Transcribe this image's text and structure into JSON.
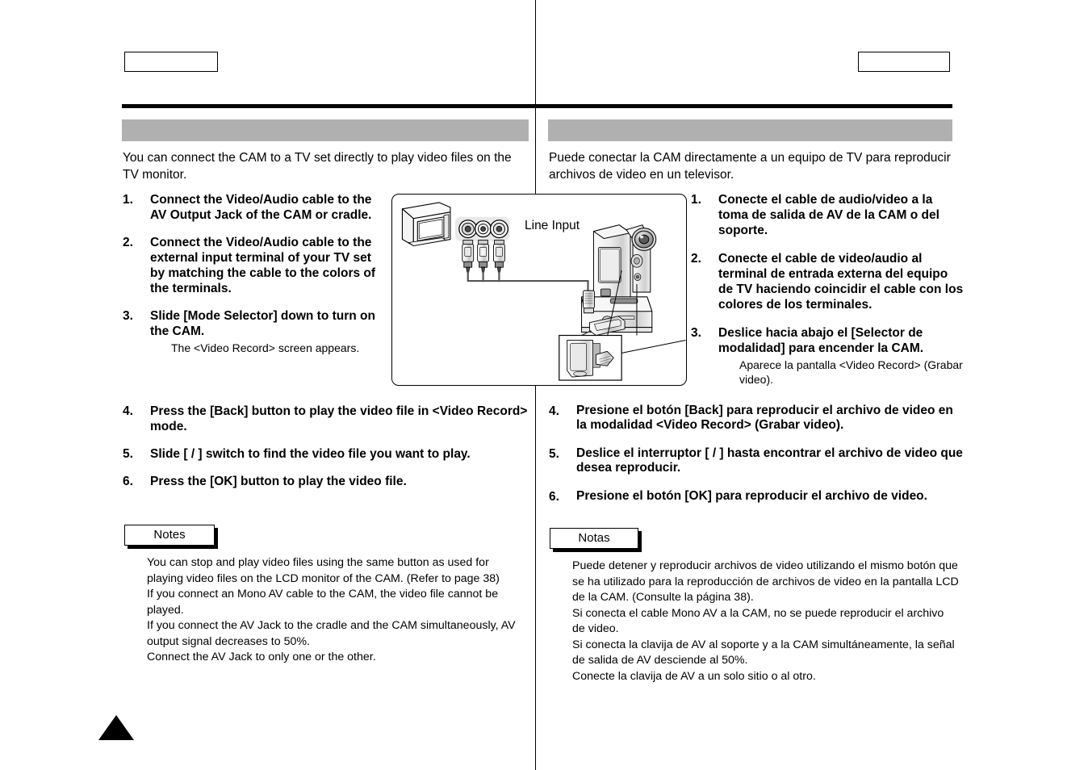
{
  "header": {
    "left_box_label": "",
    "right_box_label": ""
  },
  "section_title": {
    "left": "",
    "right": ""
  },
  "english": {
    "intro": "You can connect the CAM to a TV set directly to play video files on the TV monitor.",
    "steps_top": [
      {
        "num": "1.",
        "text": "Connect the Video/Audio cable to the AV Output Jack of the CAM or cradle.",
        "sub": ""
      },
      {
        "num": "2.",
        "text": "Connect the Video/Audio cable to the external input terminal of your TV set by matching the cable to the colors of the terminals.",
        "sub": ""
      },
      {
        "num": "3.",
        "text": "Slide [Mode Selector] down to turn on the CAM.",
        "sub": "The <Video Record> screen appears."
      }
    ],
    "steps_bottom": [
      {
        "num": "4.",
        "text": "Press the [Back] button to play the video file in <Video Record> mode.",
        "sub": ""
      },
      {
        "num": "5.",
        "text": "Slide [   /   ] switch to find the video file  you want to play.",
        "sub": ""
      },
      {
        "num": "6.",
        "text": "Press the [OK] button to play the video file.",
        "sub": ""
      }
    ],
    "notes_label": "Notes",
    "notes": [
      "You can stop and play video files using the same button as used for playing video files on the LCD monitor of the CAM. (Refer to page 38)",
      "If you connect an Mono AV cable to the CAM, the video file cannot be played.",
      "If you connect the AV Jack to the cradle and the CAM simultaneously, AV output signal decreases to 50%.",
      "Connect the AV Jack to only one or the other."
    ]
  },
  "spanish": {
    "intro": "Puede conectar la CAM directamente a un equipo de TV para reproducir archivos de video en un televisor.",
    "steps_top": [
      {
        "num": "1.",
        "text": "Conecte el cable de audio/video a la toma de salida de AV de la CAM o del soporte.",
        "sub": ""
      },
      {
        "num": "2.",
        "text": "Conecte el cable de video/audio al terminal de entrada externa del equipo de TV haciendo coincidir el cable con los colores de los terminales.",
        "sub": ""
      },
      {
        "num": "3.",
        "text": "Deslice hacia abajo el [Selector de modalidad] para encender la CAM.",
        "sub": "Aparece la pantalla <Video Record> (Grabar video)."
      }
    ],
    "steps_bottom": [
      {
        "num": "4.",
        "text": "Presione el botón [Back] para reproducir el archivo de video en la modalidad <Video Record> (Grabar video).",
        "sub": ""
      },
      {
        "num": "5.",
        "text": "Deslice el interruptor [   /   ] hasta encontrar el archivo de video que desea reproducir.",
        "sub": ""
      },
      {
        "num": "6.",
        "text": "Presione el botón [OK] para reproducir el archivo de video.",
        "sub": ""
      }
    ],
    "notes_label": "Notas",
    "notes": [
      "Puede detener y reproducir archivos de video utilizando el mismo botón que se ha utilizado para la reproducción de archivos de video en la pantalla LCD de la CAM. (Consulte la página 38).",
      "Si conecta el cable Mono AV a la CAM, no se puede reproducir el archivo de video.",
      "Si conecta la clavija de AV al soporte y a la CAM simultáneamente, la señal de salida de AV desciende al 50%.",
      "Conecte la clavija de AV a un solo sitio o al otro."
    ]
  },
  "diagram": {
    "line_input_label": "Line Input",
    "elements": [
      "tv-set-icon",
      "rca-jack-panel",
      "rca-plug-video",
      "rca-plug-audio-left",
      "rca-plug-audio-right",
      "av-cable",
      "camcorder-icon",
      "cradle-icon",
      "detail-inset-box",
      "leader-line"
    ]
  },
  "colors": {
    "section_bar": "#b0b0b0",
    "rule": "#000000",
    "page_background": "#ffffff",
    "jack_panel": "#e8e8e8"
  }
}
